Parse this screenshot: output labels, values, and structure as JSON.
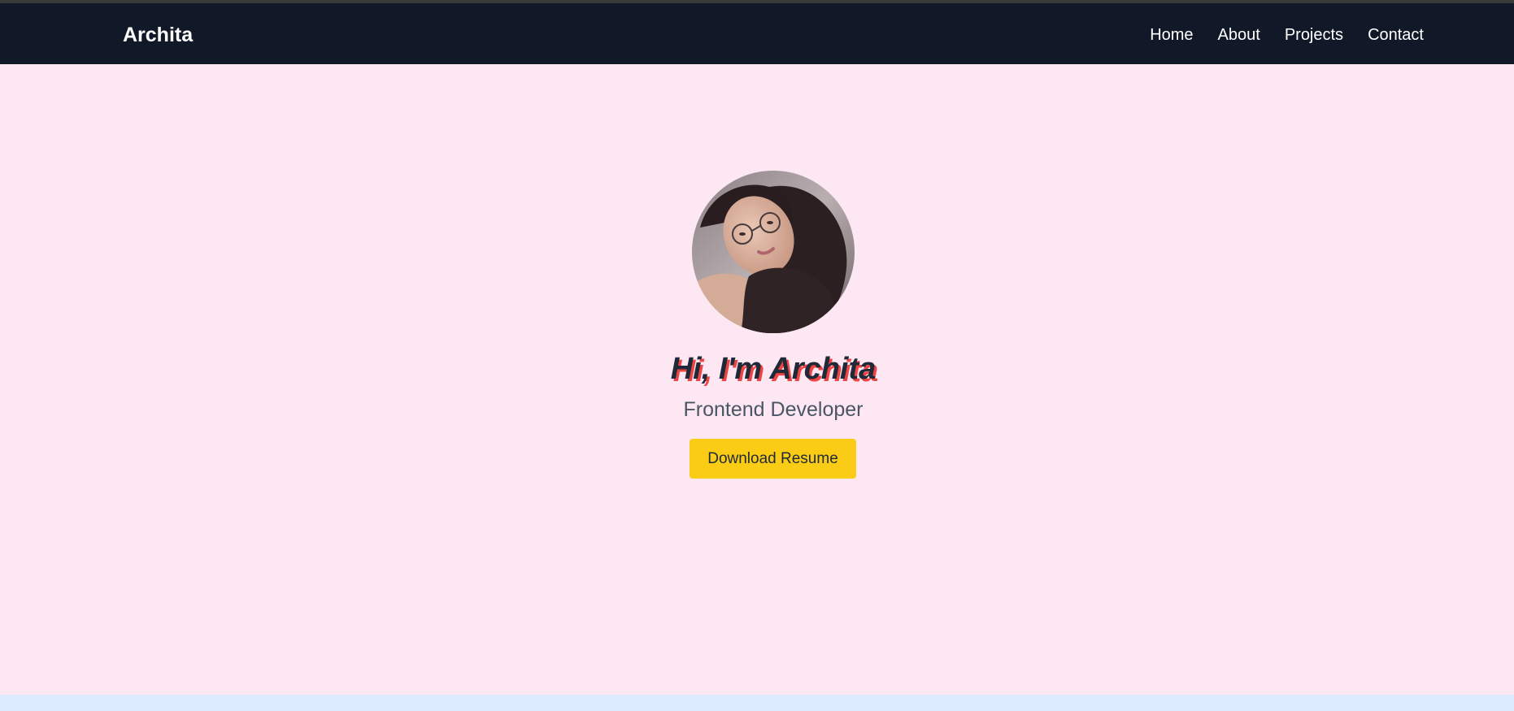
{
  "navbar": {
    "brand": "Archita",
    "links": [
      "Home",
      "About",
      "Projects",
      "Contact"
    ]
  },
  "hero": {
    "avatar_alt": "profile-photo",
    "title": "Hi, I'm Archita",
    "subtitle": "Frontend Developer",
    "button_label": "Download Resume"
  },
  "colors": {
    "navbar_bg": "#111827",
    "hero_bg": "#fce7f3",
    "next_section_bg": "#dbeafe",
    "button_bg": "#facc15",
    "title_shadow": "#ef4444"
  }
}
